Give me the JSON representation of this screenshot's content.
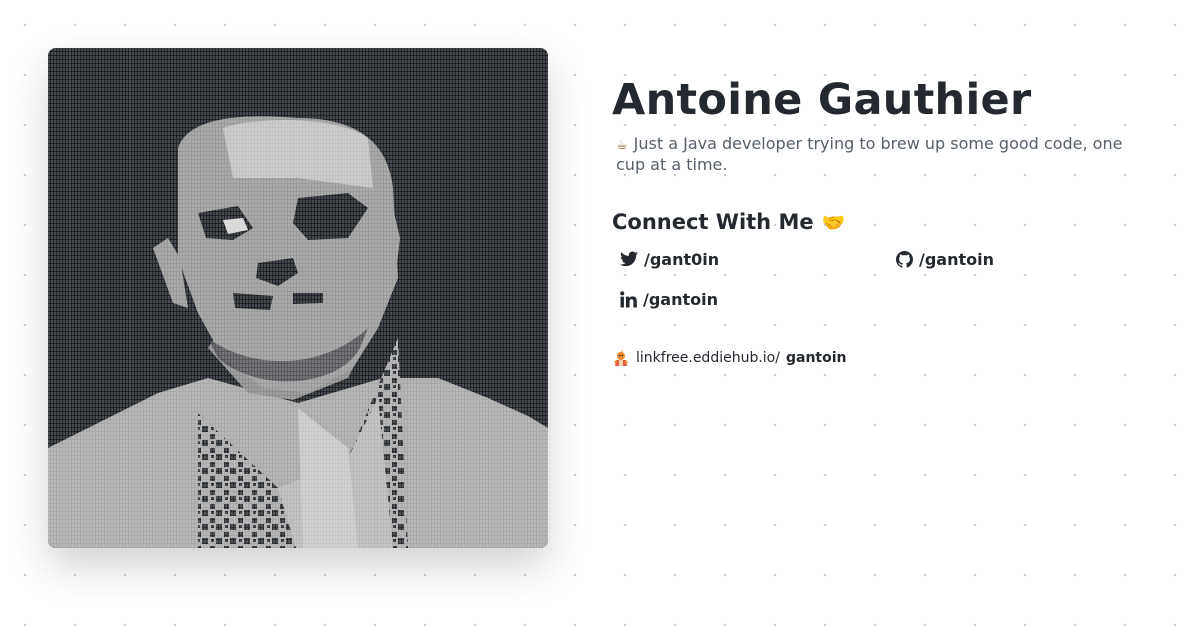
{
  "profile": {
    "name": "Antoine Gauthier",
    "bio_icon": "coffee-cup-icon",
    "bio": "Just a Java developer trying to brew up some good code, one cup at a time.",
    "photo_alt": "ascii-art portrait"
  },
  "connect": {
    "title": "Connect With Me",
    "title_icon": "handshake-icon"
  },
  "socials": [
    {
      "icon": "twitter-icon",
      "label": "/gant0in"
    },
    {
      "icon": "github-icon",
      "label": "/gantoin"
    },
    {
      "icon": "linkedin-icon",
      "label": "/gantoin"
    }
  ],
  "linkfree": {
    "icon": "linkfree-mascot-icon",
    "prefix": "linkfree.eddiehub.io/",
    "user": "gantoin"
  }
}
